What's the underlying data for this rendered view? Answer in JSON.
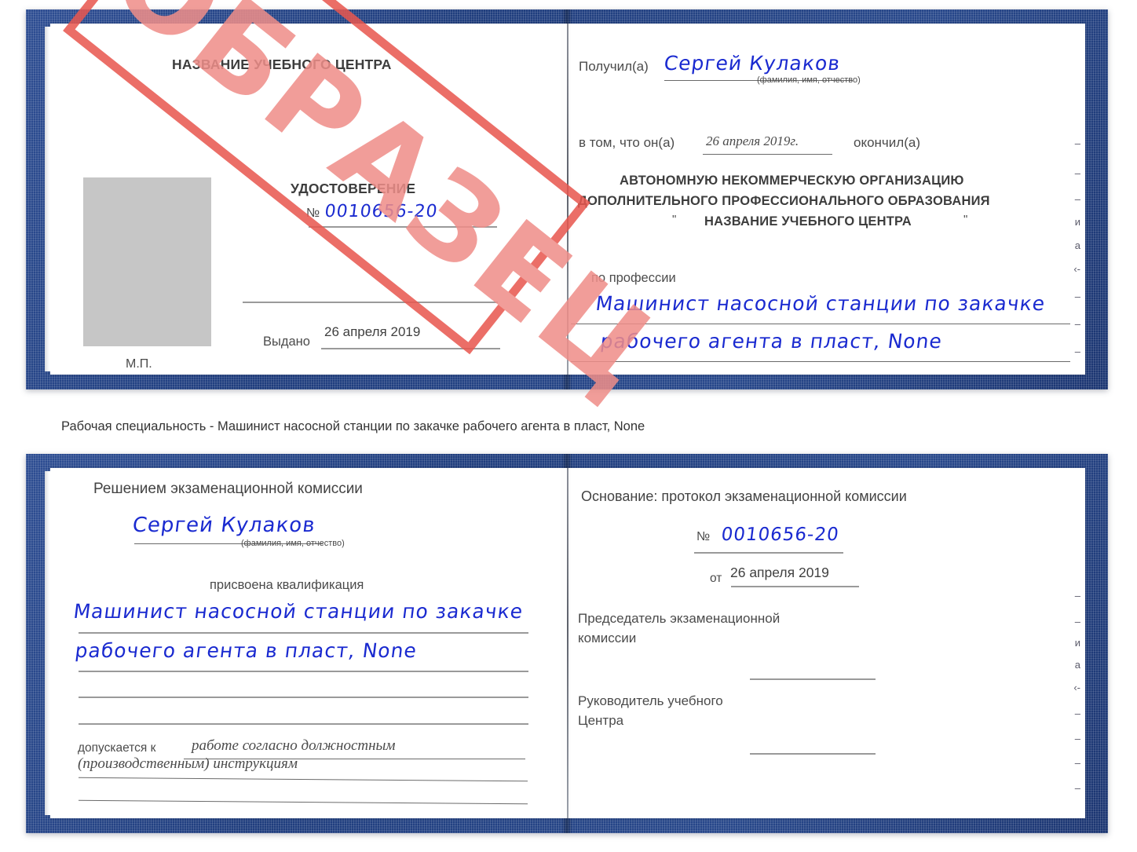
{
  "caption": {
    "text": "Рабочая специальность - Машинист насосной станции по закачке рабочего агента в пласт, None"
  },
  "stamp": {
    "label": "ОБРАЗЕЦ",
    "color": "#e8574f"
  },
  "certificate_top": {
    "left_page": {
      "org_title": "НАЗВАНИЕ УЧЕБНОГО ЦЕНТРА",
      "doc_type": "УДОСТОВЕРЕНИЕ",
      "number_label": "№",
      "number_value": "0010656-20",
      "issued_label": "Выдано",
      "issued_value": "26 апреля 2019",
      "seal_label": "М.П.",
      "photo_placeholder": "photo-box"
    },
    "right_page": {
      "received_label": "Получил(а)",
      "received_value": "Сергей Кулаков",
      "fio_hint": "(фамилия, имя, отчество)",
      "in_that_label": "в том, что он(а)",
      "in_that_value": "26 апреля 2019г.",
      "finished_label": "окончил(а)",
      "org_line1": "АВТОНОМНУЮ НЕКОММЕРЧЕСКУЮ ОРГАНИЗАЦИЮ",
      "org_line2": "ДОПОЛНИТЕЛЬНОГО ПРОФЕССИОНАЛЬНОГО ОБРАЗОВАНИЯ",
      "org_quote_open": "\"",
      "org_line3": "НАЗВАНИЕ УЧЕБНОГО ЦЕНТРА",
      "org_quote_close": "\"",
      "profession_label": "по профессии",
      "profession_line1": "Машинист насосной станции по закачке",
      "profession_line2": "рабочего агента в пласт, None",
      "margin_fragments": [
        "–",
        "–",
        "–",
        "и",
        "а",
        "‹-",
        "–",
        "–",
        "–"
      ]
    }
  },
  "certificate_bottom": {
    "left_page": {
      "heading": "Решением экзаменационной комиссии",
      "name_value": "Сергей Кулаков",
      "fio_hint": "(фамилия, имя, отчество)",
      "qualification_label": "присвоена квалификация",
      "qualification_line1": "Машинист насосной станции по закачке",
      "qualification_line2": "рабочего агента в пласт, None",
      "admitted_label": "допускается к",
      "admitted_line1": "работе согласно должностным",
      "admitted_line2": "(производственным) инструкциям"
    },
    "right_page": {
      "basis_label": "Основание: протокол экзаменационной комиссии",
      "number_label": "№",
      "number_value": "0010656-20",
      "date_label": "от",
      "date_value": "26 апреля 2019",
      "chairman_line1": "Председатель экзаменационной",
      "chairman_line2": "комиссии",
      "head_line1": "Руководитель учебного",
      "head_line2": "Центра",
      "margin_fragments": [
        "–",
        "–",
        "и",
        "а",
        "‹-",
        "–",
        "–",
        "–",
        "–"
      ]
    }
  }
}
